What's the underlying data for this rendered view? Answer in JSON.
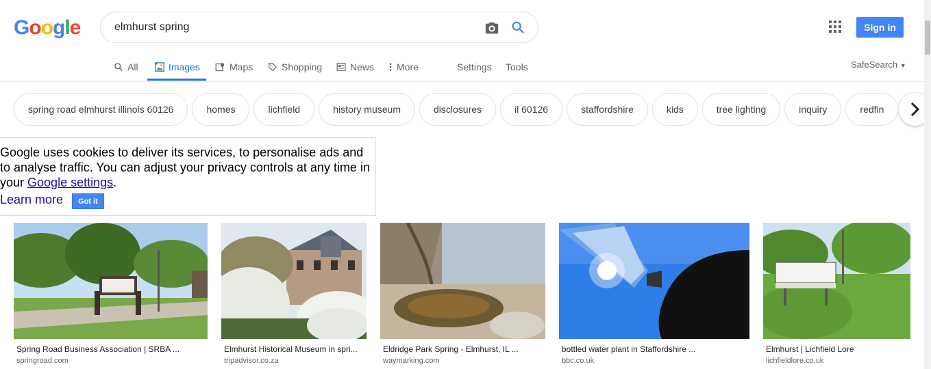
{
  "search": {
    "query": "elmhurst spring"
  },
  "header": {
    "logo": "Google",
    "signin_label": "Sign in"
  },
  "tabs": [
    {
      "label": "All",
      "icon": "search-icon"
    },
    {
      "label": "Images",
      "icon": "image-icon",
      "active": true
    },
    {
      "label": "Maps",
      "icon": "map-icon"
    },
    {
      "label": "Shopping",
      "icon": "tag-icon"
    },
    {
      "label": "News",
      "icon": "news-icon"
    },
    {
      "label": "More",
      "icon": "more-vert-icon"
    }
  ],
  "tools": {
    "settings": "Settings",
    "tools": "Tools",
    "safesearch": "SafeSearch"
  },
  "chips": [
    "spring road elmhurst illinois 60126",
    "homes",
    "lichfield",
    "history museum",
    "disclosures",
    "il 60126",
    "staffordshire",
    "kids",
    "tree lighting",
    "inquiry",
    "redfin"
  ],
  "cookie": {
    "text_before": "Google uses cookies to deliver its services, to personalise ads and to analyse traffic. You can adjust your privacy controls at any time in your ",
    "link": "Google settings",
    "text_after": ".",
    "learn_more": "Learn more",
    "got_it": "Got it"
  },
  "results": [
    {
      "title": "Spring Road Business Association | SRBA ...",
      "domain": "springroad.com"
    },
    {
      "title": "Elmhurst Historical Museum in spri...",
      "domain": "tripadvisor.co.za"
    },
    {
      "title": "Eldridge Park Spring - Elmhurst, IL ...",
      "domain": "waymarking.com"
    },
    {
      "title": "bottled water plant in Staffordshire ...",
      "domain": "bbc.co.uk"
    },
    {
      "title": "Elmhurst | Lichfield Lore",
      "domain": "lichfieldlore.co.uk"
    }
  ],
  "colors": {
    "accent": "#1a73e8",
    "button": "#4285f4",
    "link": "#1a0dab"
  }
}
